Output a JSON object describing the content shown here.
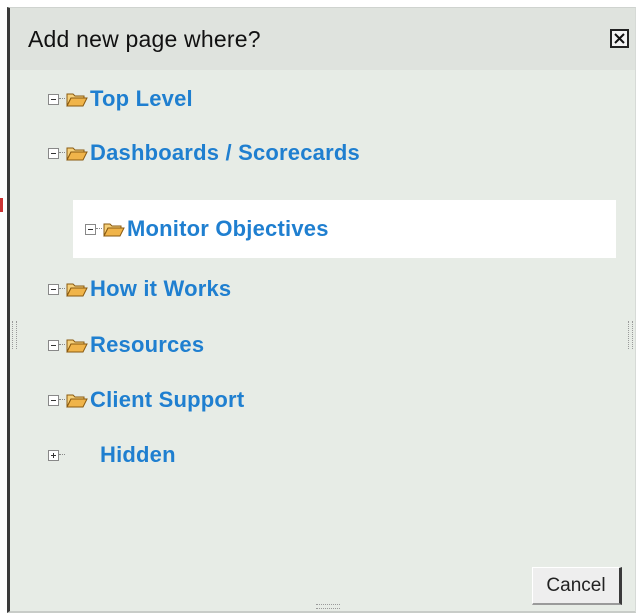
{
  "dialog": {
    "title": "Add new page where?",
    "close_icon": "close-x-icon",
    "cancel_label": "Cancel"
  },
  "tree": {
    "nodes": [
      {
        "label": "Top Level",
        "expander": "minus",
        "icon": "folder-open-icon",
        "level": 0,
        "selected": false
      },
      {
        "label": "Dashboards / Scorecards",
        "expander": "minus",
        "icon": "folder-open-icon",
        "level": 0,
        "selected": false
      },
      {
        "label": "Monitor Objectives",
        "expander": "minus",
        "icon": "folder-open-icon",
        "level": 1,
        "selected": true
      },
      {
        "label": "How it Works",
        "expander": "minus",
        "icon": "folder-open-icon",
        "level": 0,
        "selected": false
      },
      {
        "label": "Resources",
        "expander": "minus",
        "icon": "folder-open-icon",
        "level": 0,
        "selected": false
      },
      {
        "label": "Client Support",
        "expander": "minus",
        "icon": "folder-open-icon",
        "level": 0,
        "selected": false
      },
      {
        "label": "Hidden",
        "expander": "plus",
        "icon": "none",
        "level": 0,
        "selected": false
      }
    ]
  },
  "colors": {
    "link": "#1f7fd0",
    "dialog_bg": "#e7ece6",
    "selected_bg": "#ffffff",
    "folder": "#f0b44a"
  }
}
